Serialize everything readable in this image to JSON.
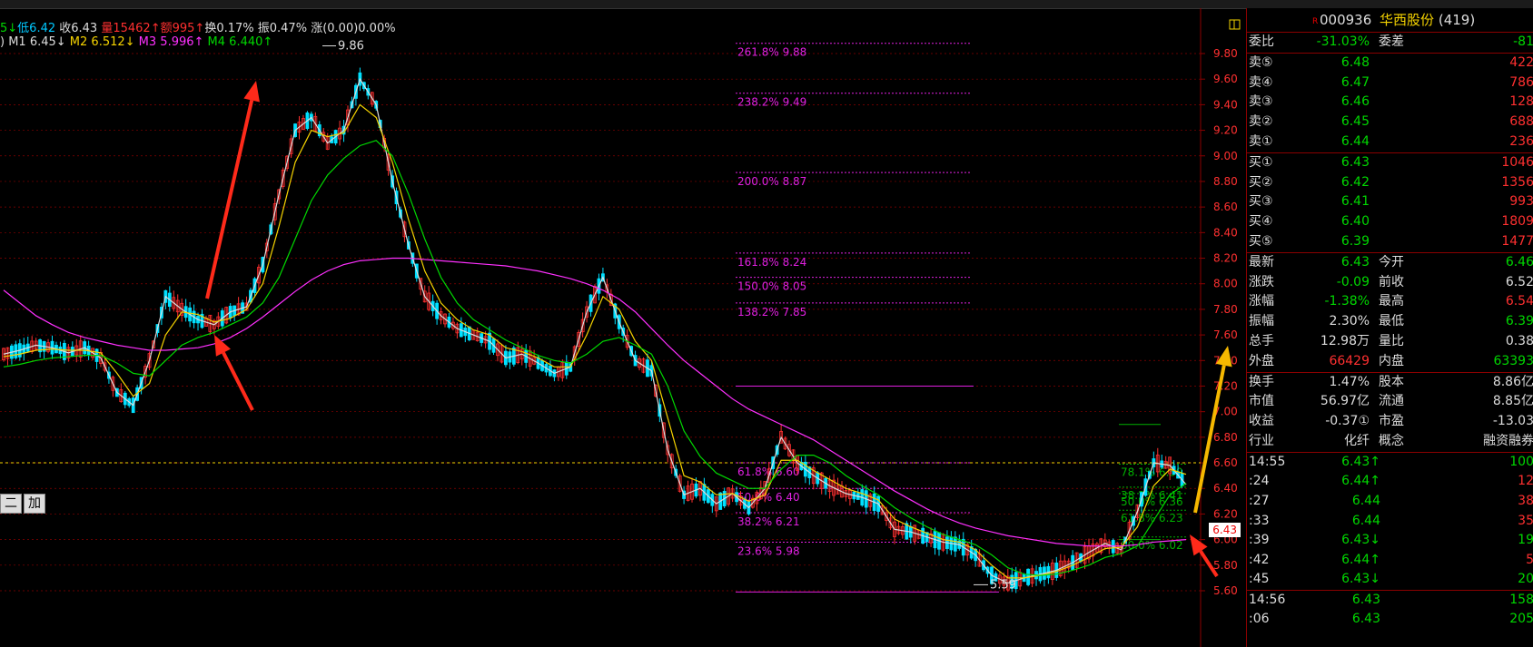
{
  "header": {
    "ohlc": [
      {
        "text": "5↓",
        "color": "#00d800"
      },
      {
        "text": "低6.42",
        "color": "#00c8ff"
      },
      {
        "text": " 收6.43",
        "color": "#dddddd"
      },
      {
        "text": " 量15462↑",
        "color": "#ff3030"
      },
      {
        "text": "额995↑",
        "color": "#ff3030"
      },
      {
        "text": "换0.17%",
        "color": "#dddddd"
      },
      {
        "text": " 振0.47%",
        "color": "#dddddd"
      },
      {
        "text": " 涨(0.00)0.00%",
        "color": "#dddddd"
      }
    ],
    "ma_line": [
      {
        "text": ")  M1 6.45↓",
        "color": "#dddddd"
      },
      {
        "text": "  M2 6.512↓",
        "color": "#f5d300"
      },
      {
        "text": "  M3 5.996↑",
        "color": "#ff30ff"
      },
      {
        "text": "  M4 6.440↑",
        "color": "#00d800"
      }
    ]
  },
  "chart_data": {
    "type": "candlestick",
    "y_ticks": [
      5.6,
      5.8,
      6.0,
      6.2,
      6.4,
      6.6,
      6.8,
      7.0,
      7.2,
      7.4,
      7.6,
      7.8,
      8.0,
      8.2,
      8.4,
      8.6,
      8.8,
      9.0,
      9.2,
      9.4,
      9.6,
      9.8
    ],
    "y_tick_labels": [
      "5.60",
      "5.80",
      "6.00",
      "6.20",
      "6.40",
      "6.60",
      "6.80",
      "7.00",
      "7.20",
      "7.40",
      "7.60",
      "7.80",
      "8.00",
      "8.20",
      "8.40",
      "8.60",
      "8.80",
      "9.00",
      "9.20",
      "9.40",
      "9.60",
      "9.80"
    ],
    "ylim": [
      5.55,
      9.99
    ],
    "high_label": "9.86",
    "low_label": "5.59",
    "current_price": "6.43",
    "fib_upper": [
      {
        "label": "261.8%  9.88",
        "value": 9.88
      },
      {
        "label": "238.2%  9.49",
        "value": 9.49
      },
      {
        "label": "200.0%  8.87",
        "value": 8.87
      },
      {
        "label": "161.8%  8.24",
        "value": 8.24
      },
      {
        "label": "150.0%  8.05",
        "value": 8.05
      },
      {
        "label": "138.2%  7.85",
        "value": 7.85
      }
    ],
    "fib_lower": [
      {
        "label": "61.8%  6.60",
        "value": 6.6
      },
      {
        "label": "50.0%  6.40",
        "value": 6.4
      },
      {
        "label": "38.2%  6.21",
        "value": 6.21
      },
      {
        "label": "23.6%  5.98",
        "value": 5.98
      }
    ],
    "fib_right": [
      {
        "label": "78.1%  6.59",
        "value": 6.59
      },
      {
        "label": "38.2%  6.41",
        "value": 6.41
      },
      {
        "label": "50.0%  6.36",
        "value": 6.36
      },
      {
        "label": "61.8%  6.23",
        "value": 6.23
      },
      {
        "label": "00.0%  6.02",
        "value": 6.02
      }
    ],
    "series": [
      {
        "name": "M1",
        "color": "#dddddd",
        "values": [
          7.45,
          7.48,
          7.52,
          7.5,
          7.46,
          7.5,
          7.42,
          7.15,
          7.05,
          7.4,
          7.9,
          7.8,
          7.72,
          7.68,
          7.78,
          7.82,
          8.15,
          8.7,
          9.2,
          9.3,
          9.1,
          9.2,
          9.6,
          9.4,
          8.8,
          8.3,
          7.9,
          7.75,
          7.65,
          7.6,
          7.55,
          7.42,
          7.45,
          7.38,
          7.3,
          7.35,
          7.78,
          8.05,
          7.7,
          7.4,
          7.32,
          6.7,
          6.35,
          6.4,
          6.28,
          6.36,
          6.25,
          6.4,
          6.8,
          6.6,
          6.5,
          6.42,
          6.36,
          6.33,
          6.28,
          6.08,
          6.06,
          6.02,
          5.98,
          5.96,
          5.88,
          5.72,
          5.66,
          5.7,
          5.73,
          5.76,
          5.82,
          5.9,
          5.97,
          5.92,
          6.22,
          6.6,
          6.58,
          6.43
        ]
      },
      {
        "name": "M2",
        "color": "#f5d300",
        "values": [
          7.43,
          7.45,
          7.48,
          7.49,
          7.48,
          7.48,
          7.46,
          7.3,
          7.12,
          7.22,
          7.6,
          7.78,
          7.76,
          7.7,
          7.73,
          7.8,
          8.0,
          8.45,
          8.95,
          9.2,
          9.15,
          9.18,
          9.4,
          9.3,
          8.95,
          8.5,
          8.1,
          7.85,
          7.72,
          7.64,
          7.6,
          7.5,
          7.47,
          7.42,
          7.35,
          7.35,
          7.6,
          7.9,
          7.8,
          7.55,
          7.4,
          6.95,
          6.5,
          6.45,
          6.35,
          6.36,
          6.3,
          6.35,
          6.62,
          6.62,
          6.54,
          6.47,
          6.4,
          6.36,
          6.31,
          6.16,
          6.1,
          6.05,
          6.0,
          5.98,
          5.92,
          5.8,
          5.7,
          5.7,
          5.72,
          5.75,
          5.8,
          5.86,
          5.93,
          5.94,
          6.1,
          6.42,
          6.55,
          6.51
        ]
      },
      {
        "name": "M3",
        "color": "#ff30ff",
        "values": [
          7.95,
          7.85,
          7.75,
          7.68,
          7.62,
          7.58,
          7.55,
          7.52,
          7.5,
          7.48,
          7.48,
          7.49,
          7.5,
          7.53,
          7.58,
          7.65,
          7.74,
          7.84,
          7.94,
          8.03,
          8.1,
          8.15,
          8.18,
          8.19,
          8.2,
          8.2,
          8.19,
          8.18,
          8.17,
          8.16,
          8.15,
          8.14,
          8.12,
          8.1,
          8.07,
          8.04,
          8.0,
          7.95,
          7.88,
          7.78,
          7.65,
          7.52,
          7.4,
          7.3,
          7.2,
          7.1,
          7.02,
          6.96,
          6.9,
          6.84,
          6.78,
          6.7,
          6.62,
          6.54,
          6.46,
          6.38,
          6.31,
          6.24,
          6.18,
          6.13,
          6.09,
          6.06,
          6.03,
          6.01,
          5.99,
          5.97,
          5.96,
          5.95,
          5.95,
          5.95,
          5.96,
          5.98,
          5.99,
          6.0
        ]
      },
      {
        "name": "M4",
        "color": "#00d800",
        "values": [
          7.35,
          7.37,
          7.4,
          7.42,
          7.43,
          7.44,
          7.44,
          7.38,
          7.3,
          7.28,
          7.4,
          7.52,
          7.58,
          7.62,
          7.68,
          7.74,
          7.85,
          8.05,
          8.35,
          8.65,
          8.85,
          8.98,
          9.08,
          9.12,
          9.0,
          8.7,
          8.35,
          8.05,
          7.85,
          7.72,
          7.64,
          7.56,
          7.5,
          7.44,
          7.4,
          7.38,
          7.45,
          7.55,
          7.58,
          7.52,
          7.45,
          7.2,
          6.85,
          6.65,
          6.52,
          6.46,
          6.4,
          6.4,
          6.55,
          6.66,
          6.66,
          6.6,
          6.5,
          6.42,
          6.35,
          6.25,
          6.17,
          6.1,
          6.04,
          6.0,
          5.96,
          5.88,
          5.78,
          5.73,
          5.72,
          5.73,
          5.76,
          5.8,
          5.86,
          5.89,
          5.95,
          6.15,
          6.35,
          6.44
        ]
      }
    ]
  },
  "quote": {
    "r_mark": "R",
    "code": "000936",
    "name": "华西股份",
    "count": "(419)",
    "ratio": {
      "l1": "委比",
      "v1": "-31.03%",
      "l2": "委差",
      "v2": "-81"
    },
    "asks": [
      {
        "label": "卖⑤",
        "price": "6.48",
        "vol": "422"
      },
      {
        "label": "卖④",
        "price": "6.47",
        "vol": "786"
      },
      {
        "label": "卖③",
        "price": "6.46",
        "vol": "128"
      },
      {
        "label": "卖②",
        "price": "6.45",
        "vol": "688"
      },
      {
        "label": "卖①",
        "price": "6.44",
        "vol": "236"
      }
    ],
    "bids": [
      {
        "label": "买①",
        "price": "6.43",
        "vol": "1046"
      },
      {
        "label": "买②",
        "price": "6.42",
        "vol": "1356"
      },
      {
        "label": "买③",
        "price": "6.41",
        "vol": "993"
      },
      {
        "label": "买④",
        "price": "6.40",
        "vol": "1809"
      },
      {
        "label": "买⑤",
        "price": "6.39",
        "vol": "1477"
      }
    ],
    "stats1": [
      {
        "l1": "最新",
        "v1": "6.43",
        "c1": "green",
        "l2": "今开",
        "v2": "6.46",
        "c2": "green",
        "lc": "yellow"
      },
      {
        "l1": "涨跌",
        "v1": "-0.09",
        "c1": "green",
        "l2": "前收",
        "v2": "6.52",
        "c2": "white",
        "lc": "white"
      },
      {
        "l1": "涨幅",
        "v1": "-1.38%",
        "c1": "green",
        "l2": "最高",
        "v2": "6.54",
        "c2": "red",
        "lc": "white"
      },
      {
        "l1": "振幅",
        "v1": "2.30%",
        "c1": "white",
        "l2": "最低",
        "v2": "6.39",
        "c2": "green",
        "lc": "white"
      },
      {
        "l1": "总手",
        "v1": "12.98万",
        "c1": "white",
        "l2": "量比",
        "v2": "0.38",
        "c2": "white",
        "lc": "white"
      },
      {
        "l1": "外盘",
        "v1": "66429",
        "c1": "red",
        "l2": "内盘",
        "v2": "63393",
        "c2": "green",
        "lc": "white"
      }
    ],
    "stats2": [
      {
        "l1": "换手",
        "v1": "1.47%",
        "c1": "white",
        "l2": "股本",
        "v2": "8.86亿",
        "c2": "white",
        "lc": "white"
      },
      {
        "l1": "市值",
        "v1": "56.97亿",
        "c1": "white",
        "l2": "流通",
        "v2": "8.85亿",
        "c2": "white",
        "lc": "white"
      },
      {
        "l1": "收益",
        "v1": "-0.37①",
        "c1": "white",
        "l2": "市盈",
        "v2": "-13.03",
        "c2": "white",
        "lc": "white"
      }
    ],
    "industry": {
      "l1": "行业",
      "v1": "化纤",
      "l2": "概念",
      "v2": "融资融券"
    },
    "ticks": [
      {
        "t": "14:55",
        "p": "6.43↑",
        "pc": "green",
        "v": "100",
        "vc": "green"
      },
      {
        "t": ":24",
        "p": "6.44↑",
        "pc": "green",
        "v": "12",
        "vc": "red"
      },
      {
        "t": ":27",
        "p": "6.44",
        "pc": "green",
        "v": "38",
        "vc": "red"
      },
      {
        "t": ":33",
        "p": "6.44",
        "pc": "green",
        "v": "35",
        "vc": "red"
      },
      {
        "t": ":39",
        "p": "6.43↓",
        "pc": "green",
        "v": "19",
        "vc": "green"
      },
      {
        "t": ":42",
        "p": "6.44↑",
        "pc": "green",
        "v": "5",
        "vc": "red"
      },
      {
        "t": ":45",
        "p": "6.43↓",
        "pc": "green",
        "v": "20",
        "vc": "green"
      },
      {
        "t": "14:56",
        "p": "6.43",
        "pc": "green",
        "v": "158",
        "vc": "green"
      },
      {
        "t": ":06",
        "p": "6.43",
        "pc": "green",
        "v": "205",
        "vc": "green"
      }
    ]
  },
  "ui": {
    "add_buttons": [
      "二",
      "加"
    ]
  },
  "colors": {
    "up": "#ff3030",
    "down": "#00e0ff",
    "grid": "#8b0000",
    "fib": "#e020e0",
    "arrow_red": "#ff2a1a",
    "arrow_yellow": "#f5b800"
  }
}
